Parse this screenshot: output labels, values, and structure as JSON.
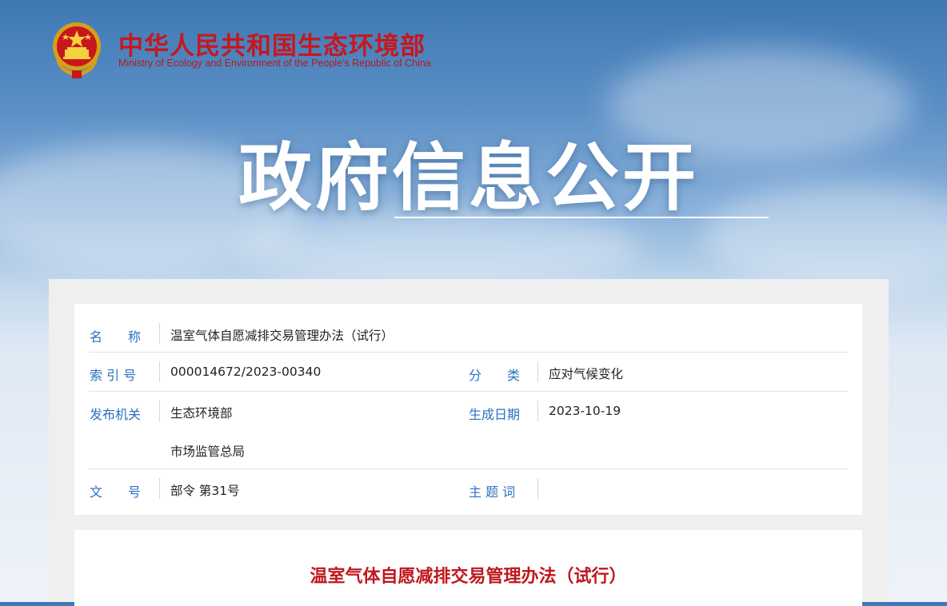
{
  "header": {
    "brand_cn": "中华人民共和国生态环境部",
    "brand_en": "Ministry of Ecology and Environment of the People's Republic of China"
  },
  "hero": {
    "title": "政府信息公开"
  },
  "metadata": {
    "name_label": "名　　称",
    "name_value": "温室气体自愿减排交易管理办法（试行）",
    "index_label": "索 引 号",
    "index_value": "000014672/2023-00340",
    "category_label": "分　　类",
    "category_value": "应对气候变化",
    "issuer_label": "发布机关",
    "issuer_value_1": "生态环境部",
    "issuer_value_2": "市场监管总局",
    "date_label": "生成日期",
    "date_value": "2023-10-19",
    "docno_label": "文　　号",
    "docno_value": "部令 第31号",
    "keywords_label": "主 题 词",
    "keywords_value": ""
  },
  "document": {
    "title": "温室气体自愿减排交易管理办法（试行）"
  },
  "colors": {
    "brand_red": "#c8161d",
    "label_blue": "#2b70c1",
    "title_red": "#c0171e"
  }
}
